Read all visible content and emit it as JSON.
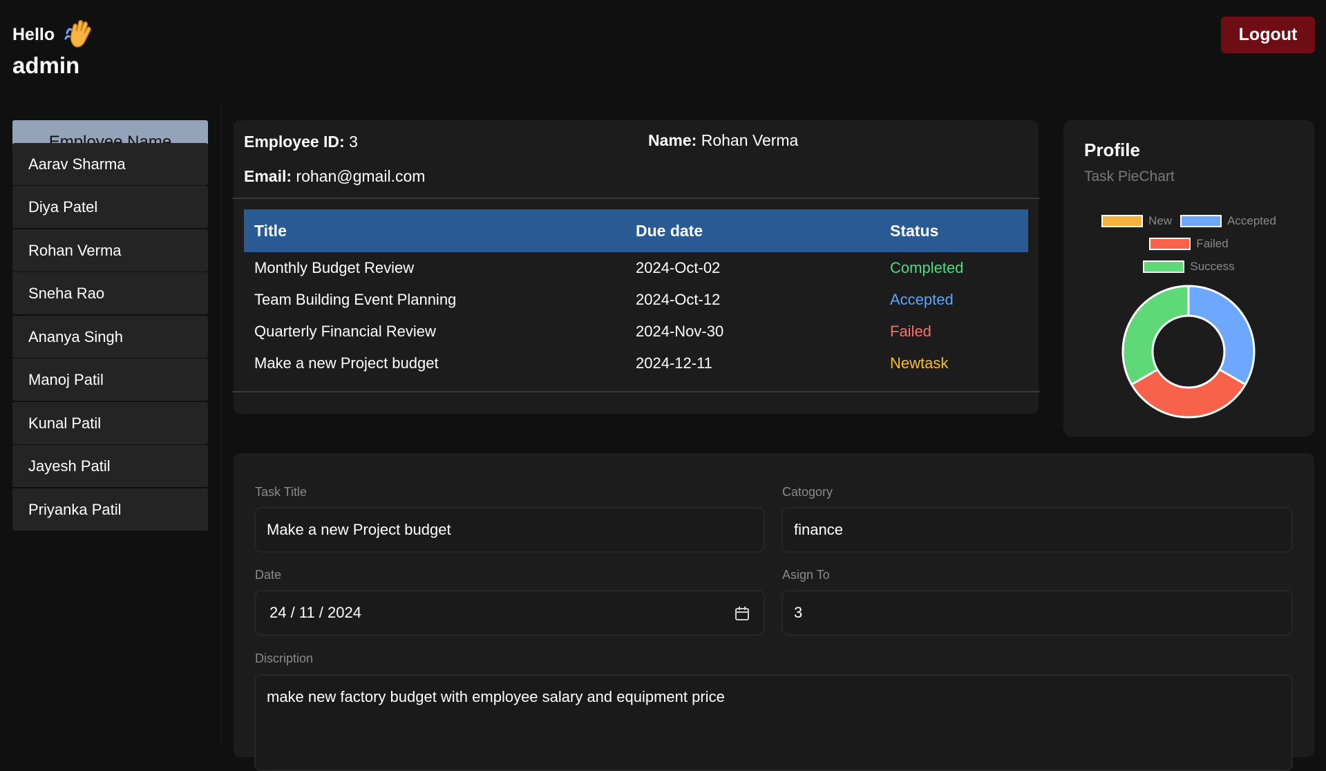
{
  "header": {
    "hello": "Hello",
    "wave_icon": "waving-hand-icon",
    "username": "admin",
    "logout_label": "Logout"
  },
  "sidebar": {
    "header": "Employee Name",
    "employees": [
      "Aarav Sharma",
      "Diya Patel",
      "Rohan Verma",
      "Sneha Rao",
      "Ananya Singh",
      "Manoj Patil",
      "Kunal Patil",
      "Jayesh Patil",
      "Priyanka Patil"
    ]
  },
  "details": {
    "id_label": "Employee ID:",
    "id_value": "3",
    "name_label": "Name:",
    "name_value": "Rohan Verma",
    "email_label": "Email:",
    "email_value": "rohan@gmail.com",
    "columns": [
      "Title",
      "Due date",
      "Status"
    ],
    "tasks": [
      {
        "title": "Monthly Budget Review",
        "due": "2024-Oct-02",
        "status": "Completed"
      },
      {
        "title": "Team Building Event Planning",
        "due": "2024-Oct-12",
        "status": "Accepted"
      },
      {
        "title": "Quarterly Financial Review",
        "due": "2024-Nov-30",
        "status": "Failed"
      },
      {
        "title": "Make a new Project budget",
        "due": "2024-12-11",
        "status": "Newtask"
      }
    ],
    "status_colors": {
      "Completed": "#4ade80",
      "Accepted": "#60a5fa",
      "Failed": "#f87171",
      "Newtask": "#fbbf24"
    }
  },
  "profile": {
    "title": "Profile",
    "subtitle": "Task PieChart",
    "legend": [
      {
        "name": "New",
        "color": "#f5b13d"
      },
      {
        "name": "Accepted",
        "color": "#6ea8fe"
      },
      {
        "name": "Failed",
        "color": "#f8614a"
      },
      {
        "name": "Success",
        "color": "#5fd878"
      }
    ]
  },
  "chart_data": {
    "type": "pie",
    "categories": [
      "New",
      "Accepted",
      "Failed",
      "Success"
    ],
    "values": [
      0,
      1,
      1,
      1
    ],
    "colors": [
      "#f5b13d",
      "#6ea8fe",
      "#f8614a",
      "#5fd878"
    ],
    "title": "Task PieChart",
    "legend_position": "top",
    "donut": true
  },
  "form": {
    "title_label": "Task Title",
    "title_value": "Make a new Project budget",
    "category_label": "Catogory",
    "category_value": "finance",
    "date_label": "Date",
    "date_value": "24 / 11 / 2024",
    "assign_label": "Asign To",
    "assign_value": "3",
    "description_label": "Discription",
    "description_value": "make new factory budget with employee salary and equipment price"
  }
}
